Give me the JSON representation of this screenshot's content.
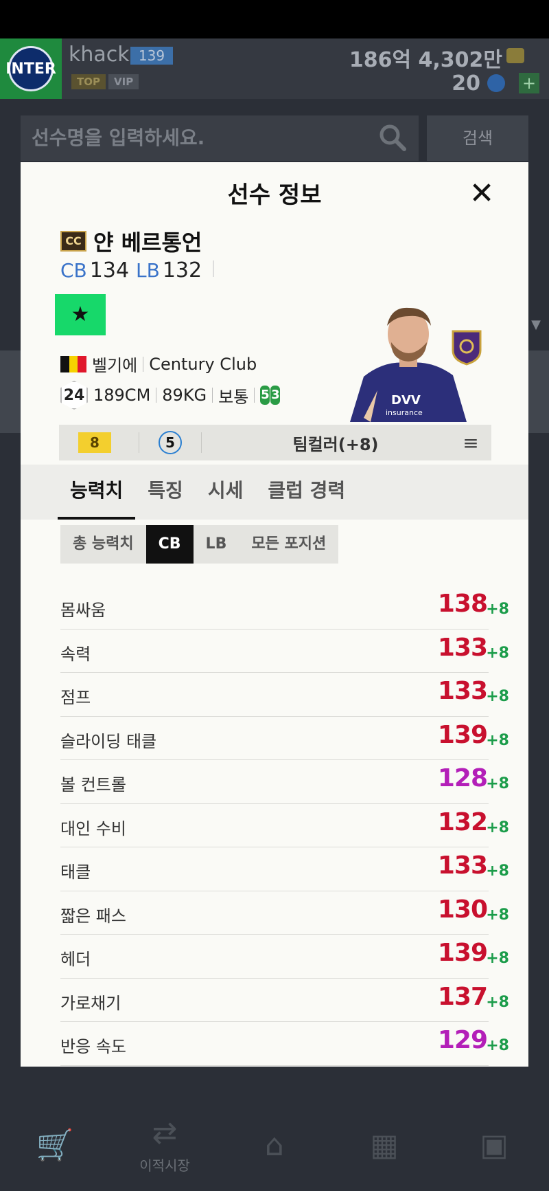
{
  "header": {
    "club_logo_text": "INTER",
    "username": "khack",
    "level": "139",
    "badges": [
      "TOP",
      "VIP"
    ],
    "coins": "186억 4,302만",
    "points": "20",
    "plus": "+"
  },
  "search": {
    "placeholder": "선수명을 입력하세요.",
    "button": "검색"
  },
  "bottom_nav": {
    "items": [
      {
        "icon": "cart-icon",
        "label": ""
      },
      {
        "icon": "transfer-icon",
        "label": "이적시장"
      },
      {
        "icon": "home-icon",
        "label": ""
      },
      {
        "icon": "formation-icon",
        "label": ""
      },
      {
        "icon": "bag-icon",
        "label": ""
      }
    ]
  },
  "modal": {
    "title": "선수 정보",
    "close": "✕",
    "season_badge": "CC",
    "player_name": "얀 베르통언",
    "positions": [
      {
        "code": "CB",
        "ovr": "134"
      },
      {
        "code": "LB",
        "ovr": "132"
      }
    ],
    "grade_symbol": "★",
    "nation": "벨기에",
    "club": "Century Club",
    "age": "24",
    "height": "189CM",
    "weight": "89KG",
    "body_type": "보통",
    "foot": [
      "5",
      "3"
    ],
    "enhance_level": "8",
    "player_level": "5",
    "team_color": "팀컬러(+8)",
    "menu": "≡",
    "tabs": [
      "능력치",
      "특징",
      "시세",
      "클럽 경력"
    ],
    "subtabs": [
      "총 능력치",
      "CB",
      "LB",
      "모든 포지션"
    ],
    "stats": [
      {
        "label": "몸싸움",
        "value": "138",
        "bonus": "+8",
        "color": "#c8102e"
      },
      {
        "label": "속력",
        "value": "133",
        "bonus": "+8",
        "color": "#c8102e"
      },
      {
        "label": "점프",
        "value": "133",
        "bonus": "+8",
        "color": "#c8102e"
      },
      {
        "label": "슬라이딩 태클",
        "value": "139",
        "bonus": "+8",
        "color": "#c8102e"
      },
      {
        "label": "볼 컨트롤",
        "value": "128",
        "bonus": "+8",
        "color": "#b31fb8"
      },
      {
        "label": "대인 수비",
        "value": "132",
        "bonus": "+8",
        "color": "#c8102e"
      },
      {
        "label": "태클",
        "value": "133",
        "bonus": "+8",
        "color": "#c8102e"
      },
      {
        "label": "짧은 패스",
        "value": "130",
        "bonus": "+8",
        "color": "#c8102e"
      },
      {
        "label": "헤더",
        "value": "139",
        "bonus": "+8",
        "color": "#c8102e"
      },
      {
        "label": "가로채기",
        "value": "137",
        "bonus": "+8",
        "color": "#c8102e"
      },
      {
        "label": "반응 속도",
        "value": "129",
        "bonus": "+8",
        "color": "#b31fb8"
      }
    ]
  }
}
